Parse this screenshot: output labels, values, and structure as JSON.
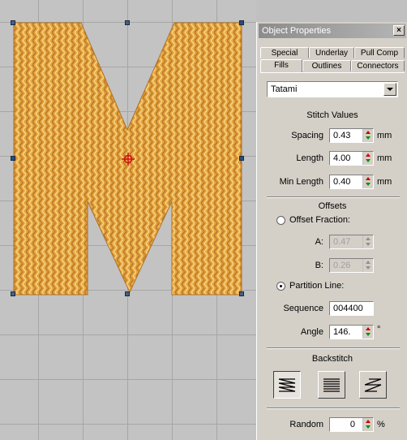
{
  "panel": {
    "title": "Object Properties",
    "close_label": "×",
    "tabs_back": [
      "Special",
      "Underlay",
      "Pull Comp"
    ],
    "tabs_front": [
      "Fills",
      "Outlines",
      "Connectors"
    ],
    "active_tab": "Fills",
    "fill_type": "Tatami"
  },
  "stitch_values": {
    "heading": "Stitch Values",
    "spacing": {
      "label": "Spacing",
      "value": "0.43",
      "unit": "mm"
    },
    "length": {
      "label": "Length",
      "value": "4.00",
      "unit": "mm"
    },
    "min_length": {
      "label": "Min Length",
      "value": "0.40",
      "unit": "mm"
    }
  },
  "offsets": {
    "heading": "Offsets",
    "offset_fraction": {
      "label": "Offset Fraction:",
      "checked": false
    },
    "a": {
      "label": "A:",
      "value": "0.47"
    },
    "b": {
      "label": "B:",
      "value": "0.26"
    },
    "partition_line": {
      "label": "Partition Line:",
      "checked": true
    },
    "sequence": {
      "label": "Sequence",
      "value": "004400"
    },
    "angle": {
      "label": "Angle",
      "value": "146.",
      "unit": "°"
    }
  },
  "backstitch": {
    "heading": "Backstitch",
    "options": [
      "backstitch-zigzag-icon",
      "backstitch-lines-icon",
      "backstitch-diagonal-icon"
    ],
    "selected": 0
  },
  "random": {
    "label": "Random",
    "value": "0",
    "unit": "%"
  },
  "canvas": {
    "object": "M",
    "fill_colors": [
      "#e8a43c",
      "#c8812a",
      "#f6d27a"
    ]
  }
}
